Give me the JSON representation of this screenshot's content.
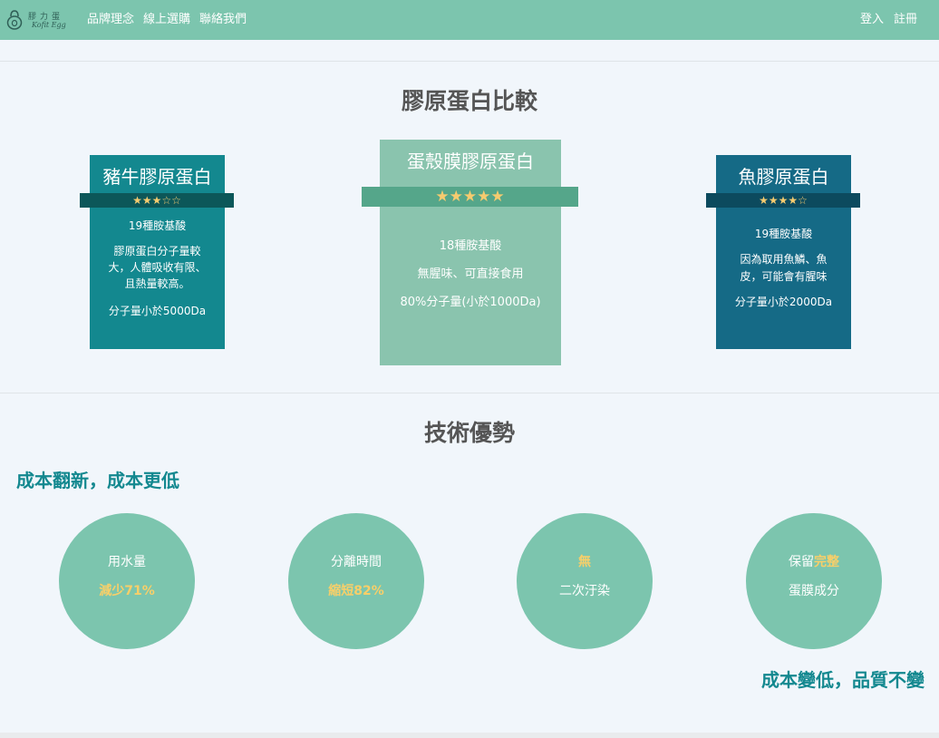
{
  "nav": {
    "logo_title": "膠力蛋",
    "logo_sub": "Kofit Egg",
    "links": [
      "品牌理念",
      "線上選購",
      "聯絡我們"
    ],
    "login": "登入",
    "register": "註冊"
  },
  "comparison": {
    "title": "膠原蛋白比較",
    "cards": [
      {
        "title": "豬牛膠原蛋白",
        "stars": "★★★☆☆",
        "rating": 3,
        "lines": [
          "19種胺基酸",
          "膠原蛋白分子量較",
          "大，人體吸收有限、",
          "且熱量較高。",
          "分子量小於5000Da"
        ]
      },
      {
        "title": "蛋殼膜膠原蛋白",
        "stars": "★★★★★",
        "rating": 5,
        "lines": [
          "18種胺基酸",
          "無腥味、可直接食用",
          "80%分子量(小於1000Da)"
        ]
      },
      {
        "title": "魚膠原蛋白",
        "stars": "★★★★☆",
        "rating": 4,
        "lines": [
          "19種胺基酸",
          "因為取用魚鱗、魚",
          "皮，可能會有腥味",
          "分子量小於2000Da"
        ]
      }
    ]
  },
  "advantages": {
    "title": "技術優勢",
    "subtitle": "成本翻新，成本更低",
    "circles": [
      {
        "top": "用水量",
        "bottom": "減少71%"
      },
      {
        "top": "分離時間",
        "bottom": "縮短82%"
      },
      {
        "top": "無",
        "bottom": "二次汙染"
      },
      {
        "top_prefix": "保留",
        "top_highlight": "完整",
        "bottom": "蛋膜成分"
      }
    ],
    "footer_slogan": "成本變低，品質不變"
  },
  "colors": {
    "navbar": "#7cc5ae",
    "pork_card": "#13888f",
    "egg_card": "#8ac4ae",
    "fish_card": "#156a86",
    "highlight": "#f8cf69",
    "accent_text": "#13888f"
  }
}
